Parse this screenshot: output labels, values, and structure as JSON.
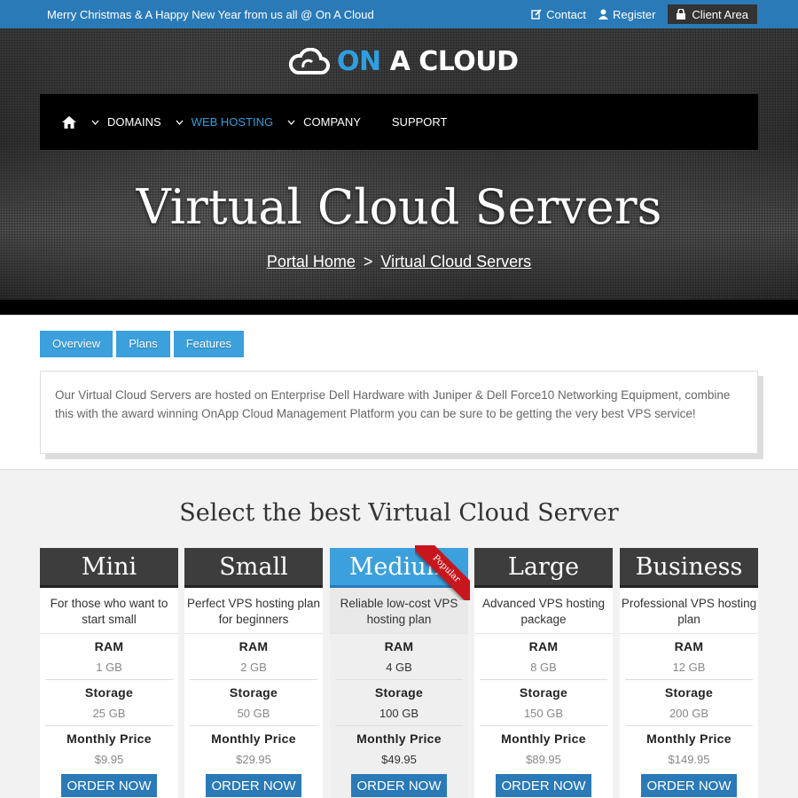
{
  "topbar": {
    "message": "Merry Christmas & A Happy New Year from us all @ On A Cloud",
    "contact": "Contact",
    "register": "Register",
    "client_area": "Client Area"
  },
  "logo": {
    "part1": "ON",
    "part2": "A CLOUD"
  },
  "nav": {
    "items": [
      {
        "label": "DOMAINS"
      },
      {
        "label": "WEB HOSTING"
      },
      {
        "label": "COMPANY"
      },
      {
        "label": "SUPPORT"
      }
    ],
    "active_color": "#2f9ee0"
  },
  "hero": {
    "title": "Virtual Cloud Servers",
    "breadcrumb": [
      "Portal Home",
      ">",
      "Virtual Cloud Servers"
    ]
  },
  "tabs": [
    "Overview",
    "Plans",
    "Features"
  ],
  "description": "Our Virtual Cloud Servers are hosted on Enterprise Dell Hardware with Juniper & Dell Force10 Networking Equipment, combine this with the award winning OnApp Cloud Management Platform you can be sure to be getting the very best VPS service!",
  "pricing": {
    "title": "Select the best Virtual Cloud Server",
    "ribbon": "Popular",
    "labels": {
      "ram": "RAM",
      "storage": "Storage",
      "price": "Monthly Price",
      "order": "ORDER NOW"
    },
    "plans": [
      {
        "name": "Mini",
        "desc": "For those who want to start small",
        "ram": "1 GB",
        "storage": "25 GB",
        "price": "$9.95"
      },
      {
        "name": "Small",
        "desc": "Perfect VPS hosting plan for beginners",
        "ram": "2 GB",
        "storage": "50 GB",
        "price": "$29.95"
      },
      {
        "name": "Medium",
        "desc": "Reliable low-cost VPS hosting plan",
        "ram": "4 GB",
        "storage": "100 GB",
        "price": "$49.95"
      },
      {
        "name": "Large",
        "desc": "Advanced VPS hosting package",
        "ram": "8 GB",
        "storage": "150 GB",
        "price": "$89.95"
      },
      {
        "name": "Business",
        "desc": "Professional VPS hosting plan",
        "ram": "12 GB",
        "storage": "200 GB",
        "price": "$149.95"
      }
    ]
  },
  "colors": {
    "topbar": "#2a7ab8",
    "accent": "#3ba0dc",
    "ribbon": "#c8161d"
  }
}
